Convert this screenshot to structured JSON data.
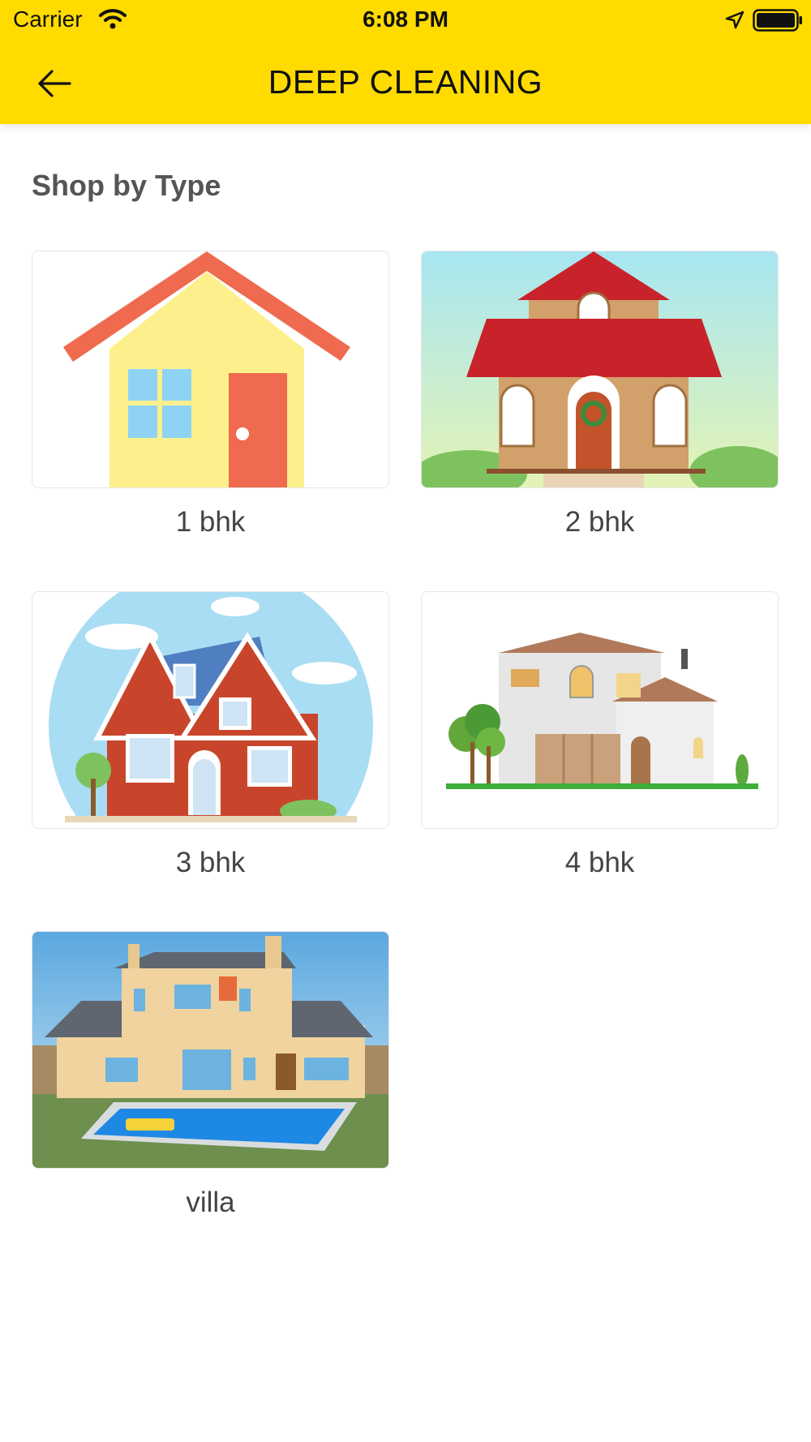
{
  "status_bar": {
    "carrier": "Carrier",
    "time": "6:08 PM"
  },
  "header": {
    "title": "DEEP CLEANING",
    "back_icon": "arrow-left-icon",
    "background": "#FFDB00"
  },
  "section": {
    "title": "Shop by Type"
  },
  "types": [
    {
      "label": "1 bhk"
    },
    {
      "label": "2 bhk"
    },
    {
      "label": "3 bhk"
    },
    {
      "label": "4 bhk"
    },
    {
      "label": "villa"
    }
  ]
}
